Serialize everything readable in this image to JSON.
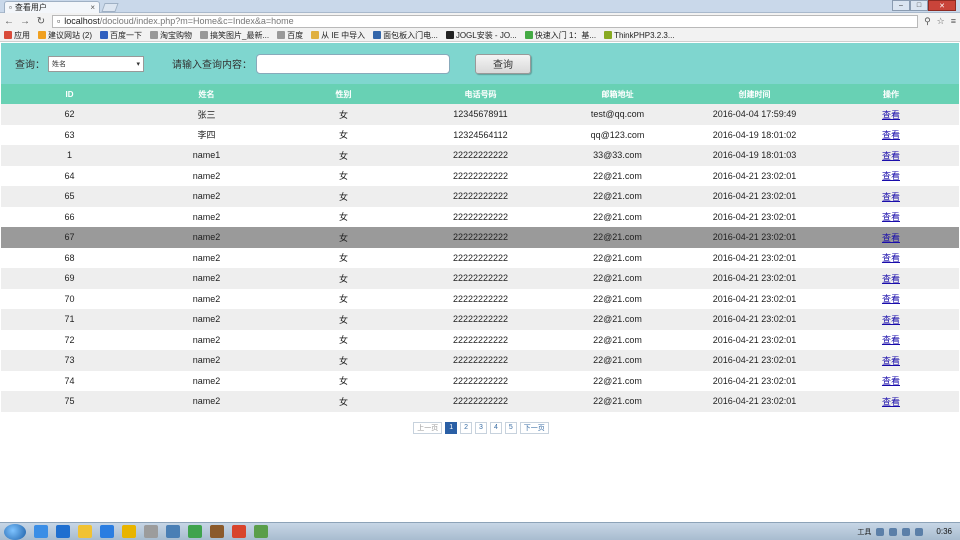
{
  "browser": {
    "tab_title": "查看用户",
    "tab_close": "×",
    "url_host": "localhost",
    "url_path": "/docloud/index.php?m=Home&c=Index&a=home",
    "bookmarks": [
      {
        "label": "应用",
        "color": "#d94b3a"
      },
      {
        "label": "建议网站 (2)",
        "color": "#f0a020"
      },
      {
        "label": "百度一下",
        "color": "#3060c0"
      },
      {
        "label": "淘宝购物",
        "color": "#999999"
      },
      {
        "label": "搞笑图片_最新...",
        "color": "#999999"
      },
      {
        "label": "百度",
        "color": "#999999"
      },
      {
        "label": "从 IE 中导入",
        "color": "#e0b040"
      },
      {
        "label": "面包板入门电...",
        "color": "#3366aa"
      },
      {
        "label": "JOGL安装 - JO...",
        "color": "#222222"
      },
      {
        "label": "快速入门 1：基...",
        "color": "#44aa44"
      },
      {
        "label": "ThinkPHP3.2.3...",
        "color": "#88aa22"
      }
    ]
  },
  "search": {
    "query_label": "查询：",
    "select_value": "姓名",
    "content_label": "请输入查询内容：",
    "input_value": "",
    "button_label": "查询"
  },
  "table": {
    "headers": [
      "ID",
      "姓名",
      "性别",
      "电话号码",
      "邮箱地址",
      "创建时间",
      "操作"
    ],
    "rows": [
      [
        "62",
        "张三",
        "女",
        "12345678911",
        "test@qq.com",
        "2016-04-04 17:59:49",
        "查看"
      ],
      [
        "63",
        "李四",
        "女",
        "12324564112",
        "qq@123.com",
        "2016-04-19 18:01:02",
        "查看"
      ],
      [
        "1",
        "name1",
        "女",
        "22222222222",
        "33@33.com",
        "2016-04-19 18:01:03",
        "查看"
      ],
      [
        "64",
        "name2",
        "女",
        "22222222222",
        "22@21.com",
        "2016-04-21 23:02:01",
        "查看"
      ],
      [
        "65",
        "name2",
        "女",
        "22222222222",
        "22@21.com",
        "2016-04-21 23:02:01",
        "查看"
      ],
      [
        "66",
        "name2",
        "女",
        "22222222222",
        "22@21.com",
        "2016-04-21 23:02:01",
        "查看"
      ],
      [
        "67",
        "name2",
        "女",
        "22222222222",
        "22@21.com",
        "2016-04-21 23:02:01",
        "查看"
      ],
      [
        "68",
        "name2",
        "女",
        "22222222222",
        "22@21.com",
        "2016-04-21 23:02:01",
        "查看"
      ],
      [
        "69",
        "name2",
        "女",
        "22222222222",
        "22@21.com",
        "2016-04-21 23:02:01",
        "查看"
      ],
      [
        "70",
        "name2",
        "女",
        "22222222222",
        "22@21.com",
        "2016-04-21 23:02:01",
        "查看"
      ],
      [
        "71",
        "name2",
        "女",
        "22222222222",
        "22@21.com",
        "2016-04-21 23:02:01",
        "查看"
      ],
      [
        "72",
        "name2",
        "女",
        "22222222222",
        "22@21.com",
        "2016-04-21 23:02:01",
        "查看"
      ],
      [
        "73",
        "name2",
        "女",
        "22222222222",
        "22@21.com",
        "2016-04-21 23:02:01",
        "查看"
      ],
      [
        "74",
        "name2",
        "女",
        "22222222222",
        "22@21.com",
        "2016-04-21 23:02:01",
        "查看"
      ],
      [
        "75",
        "name2",
        "女",
        "22222222222",
        "22@21.com",
        "2016-04-21 23:02:01",
        "查看"
      ]
    ],
    "highlighted_row_id": "67"
  },
  "pagination": {
    "prev": "上一页",
    "pages": [
      "1",
      "2",
      "3",
      "4",
      "5"
    ],
    "current": "1",
    "next": "下一页"
  },
  "taskbar": {
    "tray_text": "工具",
    "clock": "0:36",
    "app_icon_colors": [
      "#3a8ee6",
      "#1e6fd0",
      "#f1c232",
      "#2a7de1",
      "#e8b400",
      "#9c9c9c",
      "#4a7fb5",
      "#3fa34d",
      "#8b5a2b",
      "#d8442c",
      "#5a9e4a"
    ]
  },
  "colors": {
    "search_bar_bg": "#7fd6cf",
    "header_bg": "#68d1b4",
    "highlight_row": "#9a9a9a",
    "pager_active": "#2a5fa5"
  }
}
